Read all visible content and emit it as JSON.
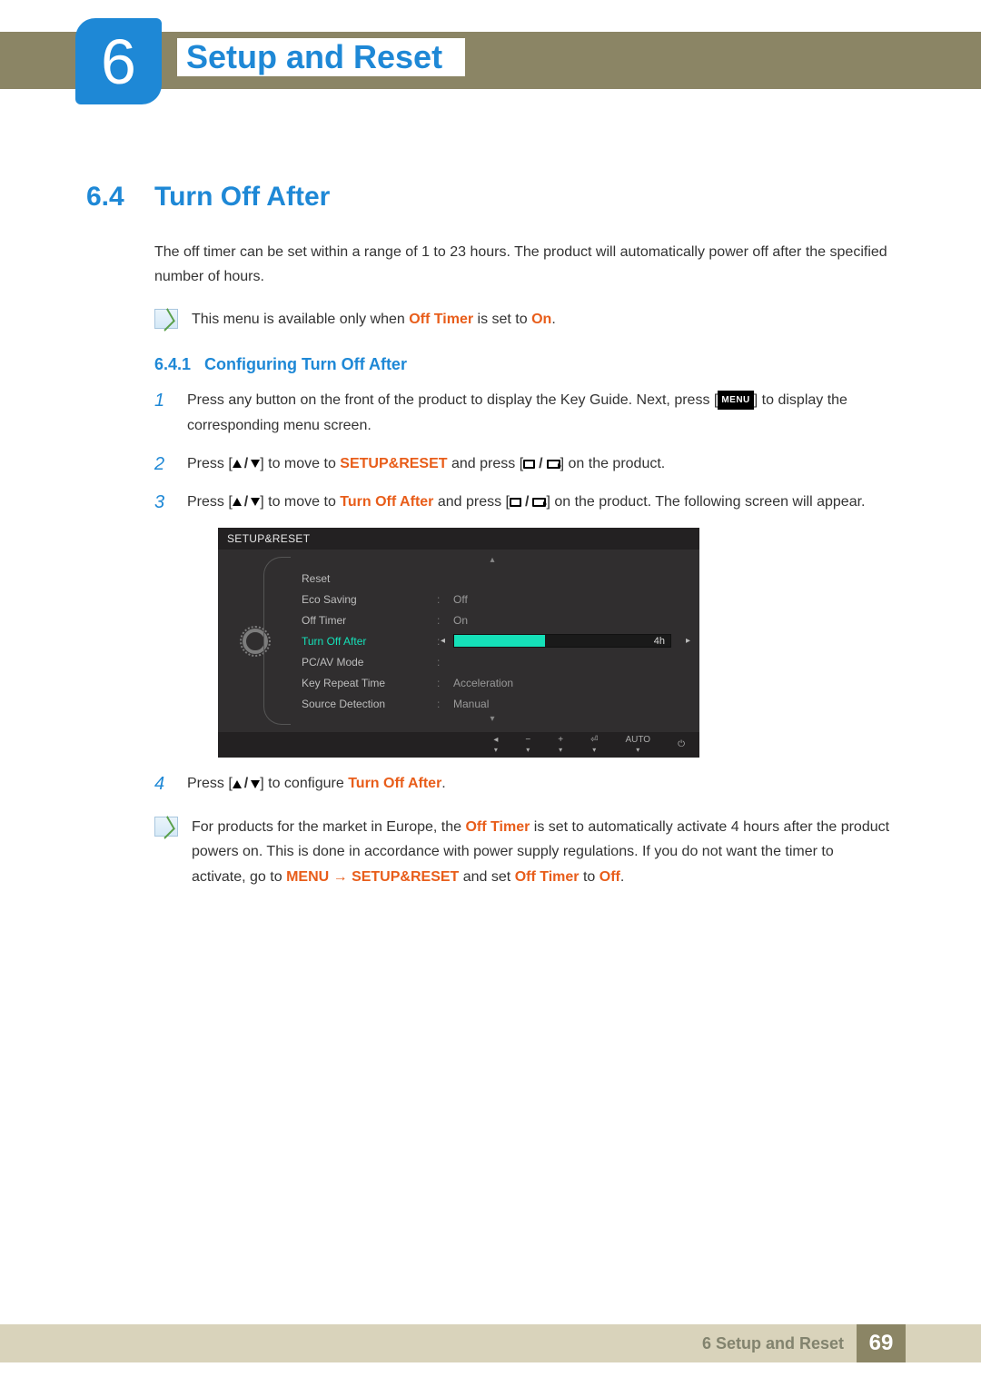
{
  "chapter": {
    "number": "6",
    "title": "Setup and Reset"
  },
  "section": {
    "number": "6.4",
    "title": "Turn Off After"
  },
  "intro": "The off timer can be set within a range of 1 to 23 hours. The product will automatically power off after the specified number of hours.",
  "note_avail": {
    "pre": "This menu is available only when ",
    "off_timer": "Off Timer",
    "mid": " is set to ",
    "on": "On",
    "end": "."
  },
  "subsection": {
    "number": "6.4.1",
    "title": "Configuring Turn Off After"
  },
  "steps": {
    "s1": {
      "n": "1",
      "a": "Press any button on the front of the product to display the Key Guide. Next, press [",
      "b": "] to display the corresponding menu screen.",
      "menu_label": "MENU"
    },
    "s2": {
      "n": "2",
      "a": "Press [",
      "b": "] to move to ",
      "target": "SETUP&RESET",
      "c": " and press [",
      "d": "] on the product."
    },
    "s3": {
      "n": "3",
      "a": "Press [",
      "b": "] to move to ",
      "target": "Turn Off After",
      "c": " and press [",
      "d": "] on the product. The following screen will appear."
    },
    "s4": {
      "n": "4",
      "a": "Press [",
      "b": "] to configure ",
      "target": "Turn Off After",
      "end": "."
    }
  },
  "osd": {
    "title": "SETUP&RESET",
    "rows": {
      "reset": "Reset",
      "eco": "Eco Saving",
      "eco_v": "Off",
      "offtimer": "Off Timer",
      "offtimer_v": "On",
      "toa": "Turn Off After",
      "toa_v": "4h",
      "pcav": "PC/AV Mode",
      "krt": "Key Repeat Time",
      "krt_v": "Acceleration",
      "srcd": "Source Detection",
      "srcd_v": "Manual"
    },
    "footer": {
      "back": "◂",
      "minus": "−",
      "plus": "+",
      "enter": "⏎",
      "auto": "AUTO",
      "power": "⏻"
    }
  },
  "note_eu": {
    "a": "For products for the market in Europe, the ",
    "off_timer": "Off Timer",
    "b": " is set to automatically activate 4 hours after the product powers on. This is done in accordance with power supply regulations. If you do not want the timer to activate, go to ",
    "menu": "MENU",
    "arrow": "  →  ",
    "setup": "SETUP&RESET",
    "c": " and set ",
    "off_timer2": "Off Timer",
    "d": " to ",
    "off": "Off",
    "end": "."
  },
  "footer": {
    "label": "6 Setup and Reset",
    "page": "69"
  }
}
